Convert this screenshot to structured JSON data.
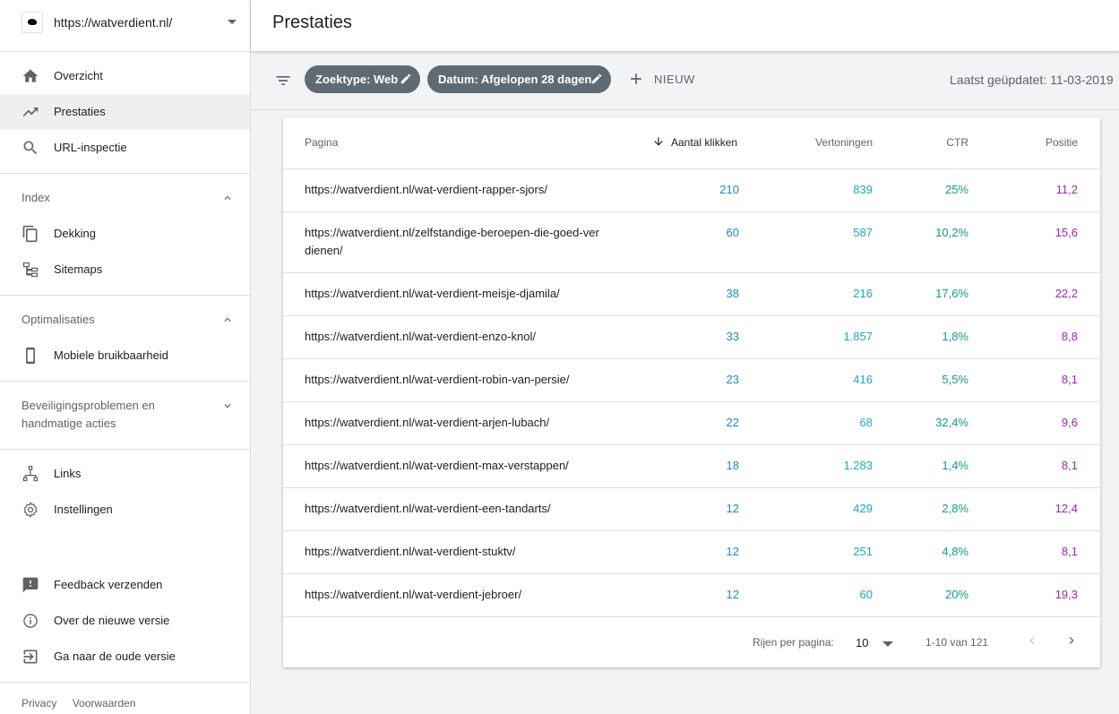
{
  "property": {
    "url": "https://watverdient.nl/"
  },
  "nav": {
    "overview": "Overzicht",
    "performance": "Prestaties",
    "url_inspection": "URL-inspectie",
    "index_header": "Index",
    "coverage": "Dekking",
    "sitemaps": "Sitemaps",
    "optim_header": "Optimalisaties",
    "mobile": "Mobiele bruikbaarheid",
    "security_header": "Beveiligingsproblemen en handmatige acties",
    "links": "Links",
    "settings": "Instellingen",
    "feedback": "Feedback verzenden",
    "about_new": "Over de nieuwe versie",
    "old_version": "Ga naar de oude versie",
    "privacy": "Privacy",
    "terms": "Voorwaarden"
  },
  "header": {
    "title": "Prestaties"
  },
  "filters": {
    "search_type": "Zoektype: Web",
    "date": "Datum: Afgelopen 28 dagen",
    "new_label": "NIEUW",
    "last_updated": "Laatst geüpdatet: 11-03-2019"
  },
  "table": {
    "columns": {
      "page": "Pagina",
      "clicks": "Aantal klikken",
      "impressions": "Vertoningen",
      "ctr": "CTR",
      "position": "Positie"
    },
    "rows": [
      {
        "url": "https://watverdient.nl/wat-verdient-rapper-sjors/",
        "clicks": "210",
        "impressions": "839",
        "ctr": "25%",
        "position": "11,2"
      },
      {
        "url": "https://watverdient.nl/zelfstandige-beroepen-die-goed-verdienen/",
        "clicks": "60",
        "impressions": "587",
        "ctr": "10,2%",
        "position": "15,6"
      },
      {
        "url": "https://watverdient.nl/wat-verdient-meisje-djamila/",
        "clicks": "38",
        "impressions": "216",
        "ctr": "17,6%",
        "position": "22,2"
      },
      {
        "url": "https://watverdient.nl/wat-verdient-enzo-knol/",
        "clicks": "33",
        "impressions": "1.857",
        "ctr": "1,8%",
        "position": "8,8"
      },
      {
        "url": "https://watverdient.nl/wat-verdient-robin-van-persie/",
        "clicks": "23",
        "impressions": "416",
        "ctr": "5,5%",
        "position": "8,1"
      },
      {
        "url": "https://watverdient.nl/wat-verdient-arjen-lubach/",
        "clicks": "22",
        "impressions": "68",
        "ctr": "32,4%",
        "position": "9,6"
      },
      {
        "url": "https://watverdient.nl/wat-verdient-max-verstappen/",
        "clicks": "18",
        "impressions": "1.283",
        "ctr": "1,4%",
        "position": "8,1"
      },
      {
        "url": "https://watverdient.nl/wat-verdient-een-tandarts/",
        "clicks": "12",
        "impressions": "429",
        "ctr": "2,8%",
        "position": "12,4"
      },
      {
        "url": "https://watverdient.nl/wat-verdient-stuktv/",
        "clicks": "12",
        "impressions": "251",
        "ctr": "4,8%",
        "position": "8,1"
      },
      {
        "url": "https://watverdient.nl/wat-verdient-jebroer/",
        "clicks": "12",
        "impressions": "60",
        "ctr": "20%",
        "position": "19,3"
      }
    ]
  },
  "pagination": {
    "rows_per_page_label": "Rijen per pagina:",
    "rows_per_page": "10",
    "range": "1-10 van 121"
  },
  "colors": {
    "clicks": "#1e88c8",
    "impressions": "#1eaab7",
    "ctr": "#129b88",
    "position": "#9c27b0",
    "chip": "#5f6b74"
  }
}
